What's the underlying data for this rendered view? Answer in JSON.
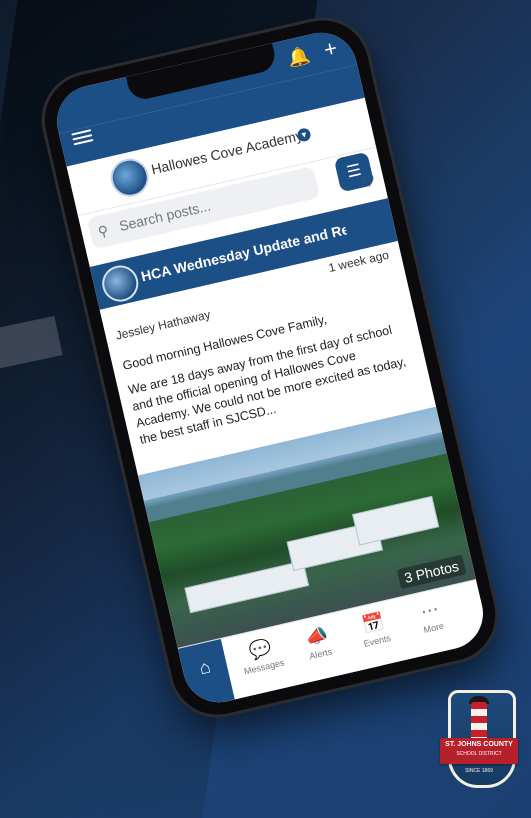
{
  "status_bar": {
    "bell_icon": "bell-icon",
    "plus_icon": "plus-icon"
  },
  "header": {
    "menu_icon": "hamburger-menu-icon",
    "school_name": "Hallowes Cove Academy",
    "verified_icon": "chevron-down-icon"
  },
  "search": {
    "placeholder": "Search posts...",
    "filter_icon": "sliders-icon",
    "favorite_icon": "heart-icon"
  },
  "post": {
    "title": "HCA Wednesday Update and Re...",
    "time": "1 week ago",
    "author": "Jessley Hathaway",
    "paragraphs": [
      "Good morning Hallowes Cove Family,",
      "We are 18 days away from the first day of school and the official opening of Hallowes Cove Academy.  We could not be more excited as today, the best staff in SJCSD..."
    ],
    "photos_label": "3 Photos"
  },
  "tabbar": {
    "items": [
      {
        "label": "",
        "icon": "home-icon"
      },
      {
        "label": "Messages",
        "icon": "chat-bubbles-icon"
      },
      {
        "label": "Alerts",
        "icon": "megaphone-icon"
      },
      {
        "label": "Events",
        "icon": "calendar-icon"
      },
      {
        "label": "More",
        "icon": "more-dots-icon"
      }
    ]
  },
  "district_badge": {
    "line1": "ST. JOHNS COUNTY",
    "line2": "SCHOOL DISTRICT",
    "since": "SINCE 1869"
  },
  "colors": {
    "brand_blue": "#1d4f87",
    "badge_red": "#b5202a"
  }
}
